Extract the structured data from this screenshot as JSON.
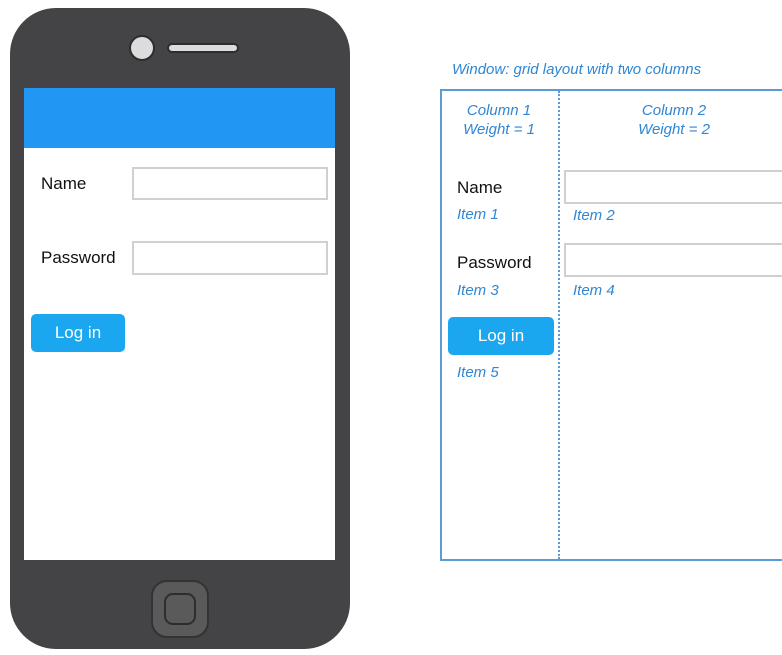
{
  "phone": {
    "form": {
      "name_label": "Name",
      "name_value": "",
      "password_label": "Password",
      "password_value": "",
      "login_label": "Log in"
    },
    "colors": {
      "app_bar": "#2196f3",
      "button": "#1aa7f0",
      "frame": "#444446"
    }
  },
  "diagram": {
    "caption": "Window: grid layout with two columns",
    "columns": [
      {
        "title": "Column 1",
        "weight": "Weight = 1"
      },
      {
        "title": "Column 2",
        "weight": "Weight = 2"
      }
    ],
    "form": {
      "name_label": "Name",
      "password_label": "Password",
      "login_label": "Log in"
    },
    "items": [
      {
        "label": "Item 1"
      },
      {
        "label": "Item 2"
      },
      {
        "label": "Item 3"
      },
      {
        "label": "Item 4"
      },
      {
        "label": "Item 5"
      }
    ],
    "colors": {
      "annotation": "#2f86d4",
      "frame": "#5a9bd8"
    }
  }
}
